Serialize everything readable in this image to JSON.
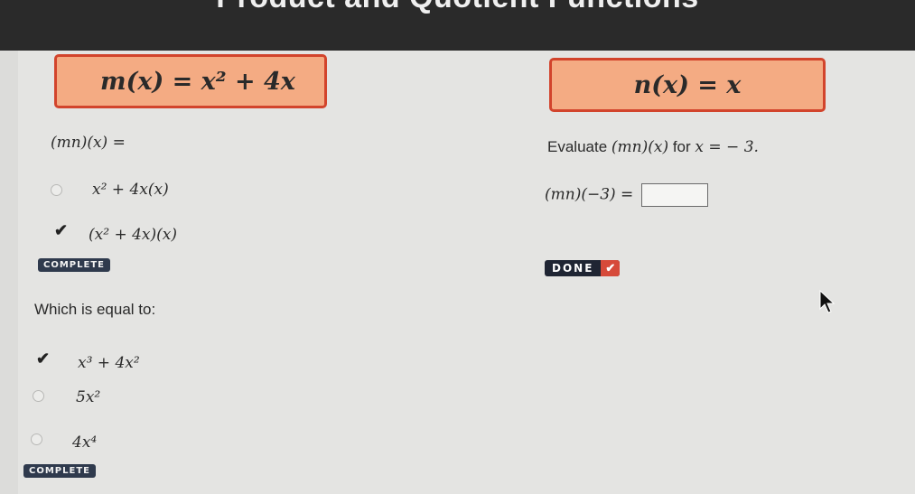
{
  "header": {
    "title": "Product and Quotient Functions"
  },
  "functions": {
    "m": "m(x) = x² + 4x",
    "n": "n(x) = x"
  },
  "question1": {
    "prompt": "(mn)(x) =",
    "options": [
      {
        "text": "x² + 4x(x)",
        "selected": false
      },
      {
        "text": "(x² + 4x)(x)",
        "selected": true
      }
    ],
    "status": "COMPLETE"
  },
  "question2": {
    "prompt_prefix": "Evaluate",
    "prompt_expr": "(mn)(x)",
    "prompt_for": "for",
    "prompt_cond": "x = − 3.",
    "equation": "(mn)(−3) =",
    "answer_value": "",
    "status": "DONE"
  },
  "question3": {
    "prompt": "Which is equal to:",
    "options": [
      {
        "text": "x³ + 4x²",
        "selected": true
      },
      {
        "text": "5x²",
        "selected": false
      },
      {
        "text": "4x⁴",
        "selected": false
      }
    ],
    "status": "COMPLETE"
  },
  "colors": {
    "function_box_fill": "#f4ab83",
    "function_box_border": "#d2442c",
    "badge_bg": "#2f3a4d",
    "done_check": "#d64a3a"
  }
}
